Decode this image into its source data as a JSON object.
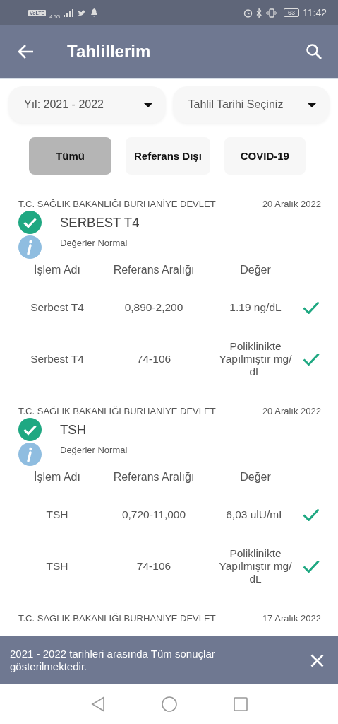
{
  "status_bar": {
    "left": [
      "VoLTE",
      "4.5G"
    ],
    "battery": "63",
    "time": "11:42"
  },
  "app_bar": {
    "title": "Tahlillerim"
  },
  "filters": [
    {
      "label": "Yıl: 2021 - 2022"
    },
    {
      "label": "Tahlil Tarihi Seçiniz"
    }
  ],
  "tabs": [
    {
      "label": "Tümü",
      "selected": true
    },
    {
      "label": "Referans Dışı",
      "selected": false
    },
    {
      "label": "COVID-19",
      "selected": false
    }
  ],
  "results": [
    {
      "institution": "T.C. SAĞLIK BAKANLIĞI BURHANİYE DEVLET",
      "date": "20 Aralık 2022",
      "title": "SERBEST T4",
      "normal": true,
      "note": "Değerler Normal",
      "columns": [
        "İşlem Adı",
        "Referans Aralığı",
        "Değer"
      ],
      "rows": [
        {
          "name": "Serbest T4",
          "range": "0,890-2,200",
          "value": "1.19 ng/dL",
          "in_range": true
        },
        {
          "name": "Serbest T4",
          "range": "74-106",
          "value": "Poliklinikte Yapılmıştır mg/ dL",
          "in_range": true
        }
      ]
    },
    {
      "institution": "T.C. SAĞLIK BAKANLIĞI BURHANİYE DEVLET",
      "date": "20 Aralık 2022",
      "title": "TSH",
      "normal": true,
      "note": "Değerler Normal",
      "columns": [
        "İşlem Adı",
        "Referans Aralığı",
        "Değer"
      ],
      "rows": [
        {
          "name": "TSH",
          "range": "0,720-11,000",
          "value": "6,03 ulU/mL",
          "in_range": true
        },
        {
          "name": "TSH",
          "range": "74-106",
          "value": "Poliklinikte Yapılmıştır mg/ dL",
          "in_range": true
        }
      ]
    },
    {
      "institution": "T.C. SAĞLIK BAKANLIĞI BURHANİYE DEVLET",
      "date": "17 Aralık 2022"
    }
  ],
  "snackbar": {
    "message": "2021 - 2022 tarihleri arasında Tüm sonuçlar gösterilmektedir."
  }
}
